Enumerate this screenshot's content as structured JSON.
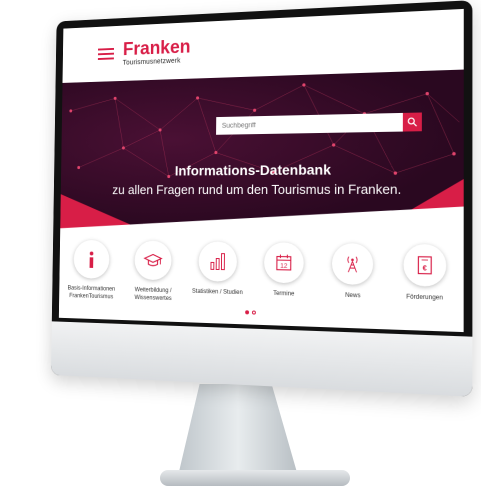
{
  "brand": {
    "name": "Franken",
    "subtitle": "Tourismusnetzwerk",
    "accent": "#d81e47"
  },
  "search": {
    "placeholder": "Suchbegriff"
  },
  "hero": {
    "title": "Informations-Datenbank",
    "subtitle": "zu allen Fragen rund um den Tourismus in Franken."
  },
  "categories": [
    {
      "label": "Basis-Informationen\nFrankenTourismus",
      "icon": "info-icon"
    },
    {
      "label": "Weiterbildung /\nWissenswertes",
      "icon": "graduation-cap-icon"
    },
    {
      "label": "Statistiken / Studien",
      "icon": "bar-chart-icon"
    },
    {
      "label": "Termine",
      "icon": "calendar-icon"
    },
    {
      "label": "News",
      "icon": "broadcast-tower-icon"
    },
    {
      "label": "Förderungen",
      "icon": "euro-document-icon"
    }
  ],
  "calendar_day": "12",
  "carousel": {
    "active_index": 0,
    "count": 2
  }
}
